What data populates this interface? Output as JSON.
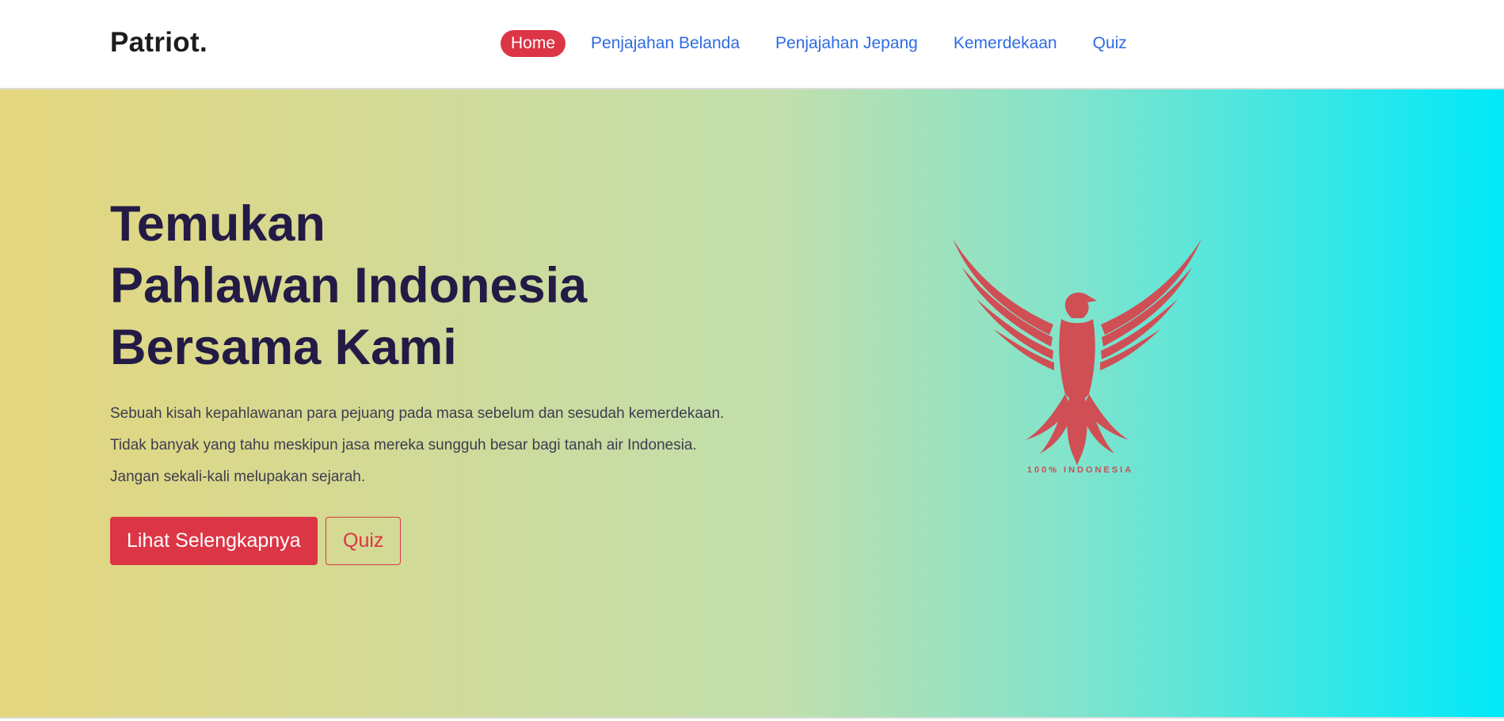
{
  "navbar": {
    "brand": "Patriot.",
    "links": [
      {
        "label": "Home",
        "active": true
      },
      {
        "label": "Penjajahan Belanda",
        "active": false
      },
      {
        "label": "Penjajahan Jepang",
        "active": false
      },
      {
        "label": "Kemerdekaan",
        "active": false
      },
      {
        "label": "Quiz",
        "active": false
      }
    ]
  },
  "hero": {
    "title_lines": [
      "Temukan",
      "Pahlawan Indonesia",
      "Bersama Kami"
    ],
    "description": "Sebuah kisah kepahlawanan para pejuang pada masa sebelum dan sesudah kemerdekaan. Tidak banyak yang tahu meskipun jasa mereka sungguh besar bagi tanah air Indonesia. Jangan sekali-kali melupakan sejarah.",
    "primary_button": "Lihat Selengkapnya",
    "secondary_button": "Quiz",
    "emblem": {
      "icon": "eagle-icon",
      "text": "100% INDONESIA"
    }
  },
  "colors": {
    "accent": "#dc3545",
    "link": "#2f6be3",
    "heading": "#231b45",
    "gradient_start": "#e4d67e",
    "gradient_end": "#00e9f9"
  }
}
